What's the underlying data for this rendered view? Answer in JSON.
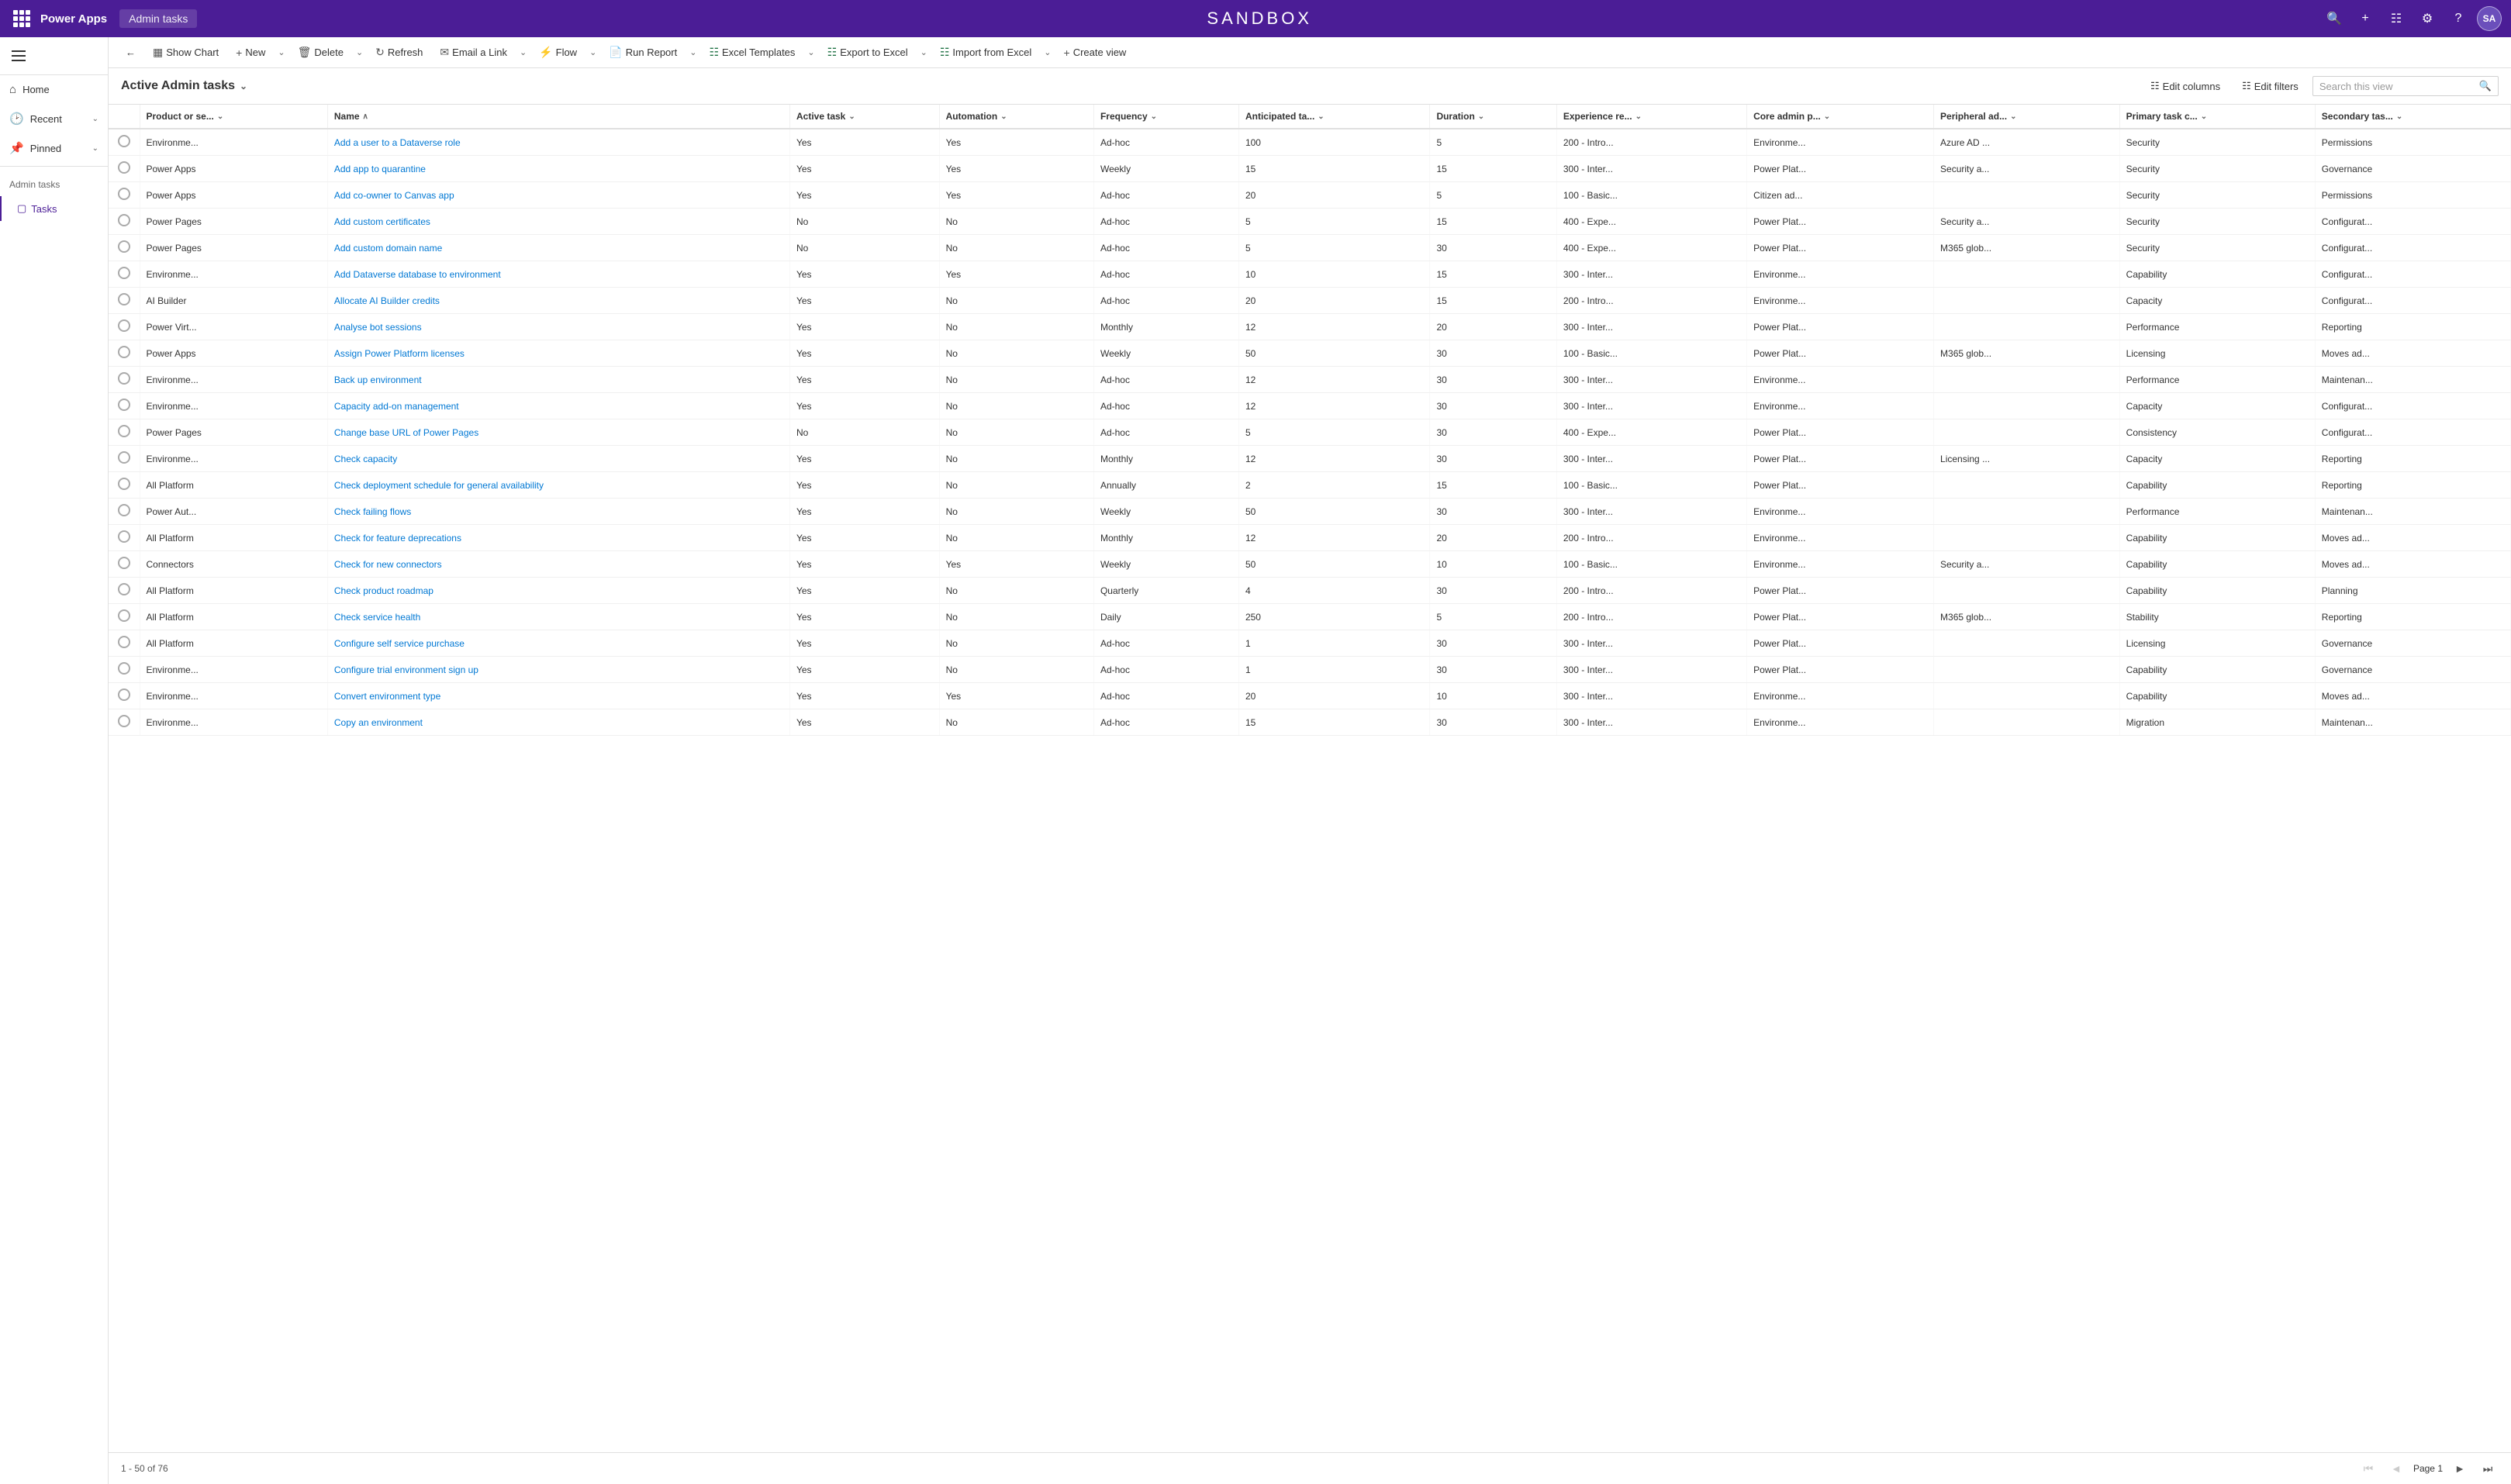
{
  "topNav": {
    "appName": "Power Apps",
    "breadcrumb": "Admin tasks",
    "sandboxTitle": "SANDBOX",
    "avatar": "SA"
  },
  "toolbar": {
    "showChart": "Show Chart",
    "new": "New",
    "delete": "Delete",
    "refresh": "Refresh",
    "emailLink": "Email a Link",
    "flow": "Flow",
    "runReport": "Run Report",
    "excelTemplates": "Excel Templates",
    "exportToExcel": "Export to Excel",
    "importFromExcel": "Import from Excel",
    "createView": "Create view"
  },
  "viewHeader": {
    "title": "Active Admin tasks",
    "editColumns": "Edit columns",
    "editFilters": "Edit filters",
    "searchPlaceholder": "Search this view"
  },
  "columns": [
    {
      "key": "radio",
      "label": ""
    },
    {
      "key": "product",
      "label": "Product or se..."
    },
    {
      "key": "name",
      "label": "Name"
    },
    {
      "key": "activeTask",
      "label": "Active task"
    },
    {
      "key": "automation",
      "label": "Automation"
    },
    {
      "key": "frequency",
      "label": "Frequency"
    },
    {
      "key": "anticipated",
      "label": "Anticipated ta..."
    },
    {
      "key": "duration",
      "label": "Duration"
    },
    {
      "key": "experience",
      "label": "Experience re..."
    },
    {
      "key": "coreAdmin",
      "label": "Core admin p..."
    },
    {
      "key": "peripheral",
      "label": "Peripheral ad..."
    },
    {
      "key": "primaryTask",
      "label": "Primary task c..."
    },
    {
      "key": "secondaryTask",
      "label": "Secondary tas..."
    }
  ],
  "rows": [
    {
      "product": "Environme...",
      "name": "Add a user to a Dataverse role",
      "activeTask": "Yes",
      "automation": "Yes",
      "frequency": "Ad-hoc",
      "anticipated": "100",
      "duration": "5",
      "experience": "200 - Intro...",
      "coreAdmin": "Environme...",
      "peripheral": "Azure AD ...",
      "primaryTask": "Security",
      "secondaryTask": "Permissions"
    },
    {
      "product": "Power Apps",
      "name": "Add app to quarantine",
      "activeTask": "Yes",
      "automation": "Yes",
      "frequency": "Weekly",
      "anticipated": "15",
      "duration": "15",
      "experience": "300 - Inter...",
      "coreAdmin": "Power Plat...",
      "peripheral": "Security a...",
      "primaryTask": "Security",
      "secondaryTask": "Governance"
    },
    {
      "product": "Power Apps",
      "name": "Add co-owner to Canvas app",
      "activeTask": "Yes",
      "automation": "Yes",
      "frequency": "Ad-hoc",
      "anticipated": "20",
      "duration": "5",
      "experience": "100 - Basic...",
      "coreAdmin": "Citizen ad...",
      "peripheral": "",
      "primaryTask": "Security",
      "secondaryTask": "Permissions"
    },
    {
      "product": "Power Pages",
      "name": "Add custom certificates",
      "activeTask": "No",
      "automation": "No",
      "frequency": "Ad-hoc",
      "anticipated": "5",
      "duration": "15",
      "experience": "400 - Expe...",
      "coreAdmin": "Power Plat...",
      "peripheral": "Security a...",
      "primaryTask": "Security",
      "secondaryTask": "Configurat..."
    },
    {
      "product": "Power Pages",
      "name": "Add custom domain name",
      "activeTask": "No",
      "automation": "No",
      "frequency": "Ad-hoc",
      "anticipated": "5",
      "duration": "30",
      "experience": "400 - Expe...",
      "coreAdmin": "Power Plat...",
      "peripheral": "M365 glob...",
      "primaryTask": "Security",
      "secondaryTask": "Configurat..."
    },
    {
      "product": "Environme...",
      "name": "Add Dataverse database to environment",
      "activeTask": "Yes",
      "automation": "Yes",
      "frequency": "Ad-hoc",
      "anticipated": "10",
      "duration": "15",
      "experience": "300 - Inter...",
      "coreAdmin": "Environme...",
      "peripheral": "",
      "primaryTask": "Capability",
      "secondaryTask": "Configurat..."
    },
    {
      "product": "AI Builder",
      "name": "Allocate AI Builder credits",
      "activeTask": "Yes",
      "automation": "No",
      "frequency": "Ad-hoc",
      "anticipated": "20",
      "duration": "15",
      "experience": "200 - Intro...",
      "coreAdmin": "Environme...",
      "peripheral": "",
      "primaryTask": "Capacity",
      "secondaryTask": "Configurat..."
    },
    {
      "product": "Power Virt...",
      "name": "Analyse bot sessions",
      "activeTask": "Yes",
      "automation": "No",
      "frequency": "Monthly",
      "anticipated": "12",
      "duration": "20",
      "experience": "300 - Inter...",
      "coreAdmin": "Power Plat...",
      "peripheral": "",
      "primaryTask": "Performance",
      "secondaryTask": "Reporting"
    },
    {
      "product": "Power Apps",
      "name": "Assign Power Platform licenses",
      "activeTask": "Yes",
      "automation": "No",
      "frequency": "Weekly",
      "anticipated": "50",
      "duration": "30",
      "experience": "100 - Basic...",
      "coreAdmin": "Power Plat...",
      "peripheral": "M365 glob...",
      "primaryTask": "Licensing",
      "secondaryTask": "Moves ad..."
    },
    {
      "product": "Environme...",
      "name": "Back up environment",
      "activeTask": "Yes",
      "automation": "No",
      "frequency": "Ad-hoc",
      "anticipated": "12",
      "duration": "30",
      "experience": "300 - Inter...",
      "coreAdmin": "Environme...",
      "peripheral": "",
      "primaryTask": "Performance",
      "secondaryTask": "Maintenan..."
    },
    {
      "product": "Environme...",
      "name": "Capacity add-on management",
      "activeTask": "Yes",
      "automation": "No",
      "frequency": "Ad-hoc",
      "anticipated": "12",
      "duration": "30",
      "experience": "300 - Inter...",
      "coreAdmin": "Environme...",
      "peripheral": "",
      "primaryTask": "Capacity",
      "secondaryTask": "Configurat..."
    },
    {
      "product": "Power Pages",
      "name": "Change base URL of Power Pages",
      "activeTask": "No",
      "automation": "No",
      "frequency": "Ad-hoc",
      "anticipated": "5",
      "duration": "30",
      "experience": "400 - Expe...",
      "coreAdmin": "Power Plat...",
      "peripheral": "",
      "primaryTask": "Consistency",
      "secondaryTask": "Configurat..."
    },
    {
      "product": "Environme...",
      "name": "Check capacity",
      "activeTask": "Yes",
      "automation": "No",
      "frequency": "Monthly",
      "anticipated": "12",
      "duration": "30",
      "experience": "300 - Inter...",
      "coreAdmin": "Power Plat...",
      "peripheral": "Licensing ...",
      "primaryTask": "Capacity",
      "secondaryTask": "Reporting"
    },
    {
      "product": "All Platform",
      "name": "Check deployment schedule for general availability",
      "activeTask": "Yes",
      "automation": "No",
      "frequency": "Annually",
      "anticipated": "2",
      "duration": "15",
      "experience": "100 - Basic...",
      "coreAdmin": "Power Plat...",
      "peripheral": "",
      "primaryTask": "Capability",
      "secondaryTask": "Reporting"
    },
    {
      "product": "Power Aut...",
      "name": "Check failing flows",
      "activeTask": "Yes",
      "automation": "No",
      "frequency": "Weekly",
      "anticipated": "50",
      "duration": "30",
      "experience": "300 - Inter...",
      "coreAdmin": "Environme...",
      "peripheral": "",
      "primaryTask": "Performance",
      "secondaryTask": "Maintenan..."
    },
    {
      "product": "All Platform",
      "name": "Check for feature deprecations",
      "activeTask": "Yes",
      "automation": "No",
      "frequency": "Monthly",
      "anticipated": "12",
      "duration": "20",
      "experience": "200 - Intro...",
      "coreAdmin": "Environme...",
      "peripheral": "",
      "primaryTask": "Capability",
      "secondaryTask": "Moves ad..."
    },
    {
      "product": "Connectors",
      "name": "Check for new connectors",
      "activeTask": "Yes",
      "automation": "Yes",
      "frequency": "Weekly",
      "anticipated": "50",
      "duration": "10",
      "experience": "100 - Basic...",
      "coreAdmin": "Environme...",
      "peripheral": "Security a...",
      "primaryTask": "Capability",
      "secondaryTask": "Moves ad..."
    },
    {
      "product": "All Platform",
      "name": "Check product roadmap",
      "activeTask": "Yes",
      "automation": "No",
      "frequency": "Quarterly",
      "anticipated": "4",
      "duration": "30",
      "experience": "200 - Intro...",
      "coreAdmin": "Power Plat...",
      "peripheral": "",
      "primaryTask": "Capability",
      "secondaryTask": "Planning"
    },
    {
      "product": "All Platform",
      "name": "Check service health",
      "activeTask": "Yes",
      "automation": "No",
      "frequency": "Daily",
      "anticipated": "250",
      "duration": "5",
      "experience": "200 - Intro...",
      "coreAdmin": "Power Plat...",
      "peripheral": "M365 glob...",
      "primaryTask": "Stability",
      "secondaryTask": "Reporting"
    },
    {
      "product": "All Platform",
      "name": "Configure self service purchase",
      "activeTask": "Yes",
      "automation": "No",
      "frequency": "Ad-hoc",
      "anticipated": "1",
      "duration": "30",
      "experience": "300 - Inter...",
      "coreAdmin": "Power Plat...",
      "peripheral": "",
      "primaryTask": "Licensing",
      "secondaryTask": "Governance"
    },
    {
      "product": "Environme...",
      "name": "Configure trial environment sign up",
      "activeTask": "Yes",
      "automation": "No",
      "frequency": "Ad-hoc",
      "anticipated": "1",
      "duration": "30",
      "experience": "300 - Inter...",
      "coreAdmin": "Power Plat...",
      "peripheral": "",
      "primaryTask": "Capability",
      "secondaryTask": "Governance"
    },
    {
      "product": "Environme...",
      "name": "Convert environment type",
      "activeTask": "Yes",
      "automation": "Yes",
      "frequency": "Ad-hoc",
      "anticipated": "20",
      "duration": "10",
      "experience": "300 - Inter...",
      "coreAdmin": "Environme...",
      "peripheral": "",
      "primaryTask": "Capability",
      "secondaryTask": "Moves ad..."
    },
    {
      "product": "Environme...",
      "name": "Copy an environment",
      "activeTask": "Yes",
      "automation": "No",
      "frequency": "Ad-hoc",
      "anticipated": "15",
      "duration": "30",
      "experience": "300 - Inter...",
      "coreAdmin": "Environme...",
      "peripheral": "",
      "primaryTask": "Migration",
      "secondaryTask": "Maintenan..."
    }
  ],
  "footer": {
    "count": "1 - 50 of 76",
    "page": "Page 1"
  },
  "sidebar": {
    "home": "Home",
    "recent": "Recent",
    "pinned": "Pinned",
    "section": "Admin tasks",
    "tasks": "Tasks"
  }
}
